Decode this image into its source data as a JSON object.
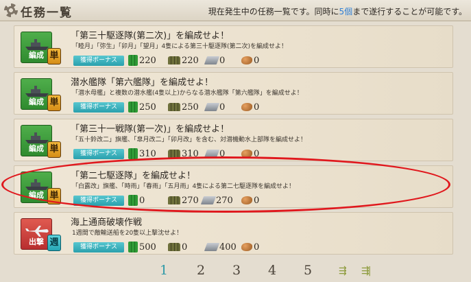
{
  "header": {
    "title": "任務一覧",
    "note_pre": "現在発生中の任務一覧です。同時に",
    "note_count": "5個",
    "note_post": "まで遂行することが可能です。"
  },
  "quests": [
    {
      "category": "編成",
      "category_type": "compose",
      "frequency": "単",
      "title": "「第三十駆逐隊(第二次)」を編成せよ！",
      "desc": "「睦月」「弥生」「卯月」「望月」4隻による第三十駆逐隊(第二次)を編成せよ！",
      "bonus": "獲得ボーナス",
      "fuel": "220",
      "ammo": "220",
      "steel": "0",
      "bauxite": "0"
    },
    {
      "category": "編成",
      "category_type": "compose",
      "frequency": "単",
      "title": "潜水艦隊「第六艦隊」を編成せよ！",
      "desc": "「潜水母艦」と複数の潜水艦(4隻以上)からなる潜水艦隊「第六艦隊」を編成せよ！",
      "bonus": "獲得ボーナス",
      "fuel": "250",
      "ammo": "250",
      "steel": "0",
      "bauxite": "0"
    },
    {
      "category": "編成",
      "category_type": "compose",
      "frequency": "単",
      "title": "「第三十一戦隊(第一次)」を編成せよ！",
      "desc": "「五十鈴改二」旗艦、「皐月改二」「卯月改」を含む、対潜機動水上部隊を編成せよ！",
      "bonus": "獲得ボーナス",
      "fuel": "310",
      "ammo": "310",
      "steel": "0",
      "bauxite": "0"
    },
    {
      "category": "編成",
      "category_type": "compose",
      "frequency": "単",
      "title": "「第二七駆逐隊」を編成せよ！",
      "desc": "「白露改」旗艦、「時雨」「春雨」「五月雨」4隻による第二七駆逐隊を編成せよ！",
      "bonus": "獲得ボーナス",
      "fuel": "0",
      "ammo": "270",
      "steel": "270",
      "bauxite": "0"
    },
    {
      "category": "出撃",
      "category_type": "sortie",
      "frequency": "週",
      "title": "海上通商破壊作戦",
      "desc": "1週間で敵輸送船を20隻以上撃沈せよ！",
      "bonus": "獲得ボーナス",
      "fuel": "500",
      "ammo": "0",
      "steel": "400",
      "bauxite": "0"
    }
  ],
  "pager": {
    "pages": [
      "1",
      "2",
      "3",
      "4",
      "5"
    ],
    "current": "1",
    "next_icon": "next-arrow-icon",
    "last_icon": "last-arrow-icon"
  },
  "colors": {
    "accent": "#2f7fd4",
    "compose": "#3f9d3c",
    "sortie": "#c93a34",
    "single": "#e8a22a",
    "weekly": "#3ab8c6",
    "highlight": "#e0181d"
  }
}
